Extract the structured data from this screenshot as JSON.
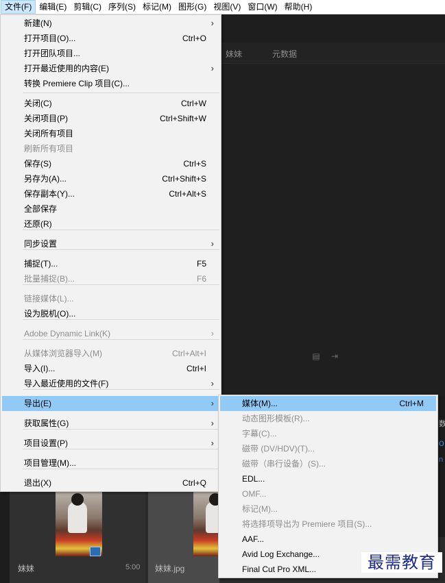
{
  "menubar": {
    "items": [
      "文件(F)",
      "编辑(E)",
      "剪辑(C)",
      "序列(S)",
      "标记(M)",
      "图形(G)",
      "视图(V)",
      "窗口(W)",
      "帮助(H)"
    ]
  },
  "panel": {
    "tabs": [
      "妹妹",
      "元数据"
    ]
  },
  "file_menu": {
    "items": [
      {
        "label": "新建(N)",
        "shortcut": "",
        "submenu": true,
        "disabled": false
      },
      {
        "label": "打开项目(O)...",
        "shortcut": "Ctrl+O",
        "submenu": false,
        "disabled": false
      },
      {
        "label": "打开团队项目...",
        "shortcut": "",
        "submenu": false,
        "disabled": false
      },
      {
        "label": "打开最近使用的内容(E)",
        "shortcut": "",
        "submenu": true,
        "disabled": false
      },
      {
        "label": "转换 Premiere Clip 项目(C)...",
        "shortcut": "",
        "submenu": false,
        "disabled": false
      },
      {
        "label": "关闭(C)",
        "shortcut": "Ctrl+W",
        "submenu": false,
        "disabled": false
      },
      {
        "label": "关闭项目(P)",
        "shortcut": "Ctrl+Shift+W",
        "submenu": false,
        "disabled": false
      },
      {
        "label": "关闭所有项目",
        "shortcut": "",
        "submenu": false,
        "disabled": false
      },
      {
        "label": "刷新所有项目",
        "shortcut": "",
        "submenu": false,
        "disabled": true
      },
      {
        "label": "保存(S)",
        "shortcut": "Ctrl+S",
        "submenu": false,
        "disabled": false
      },
      {
        "label": "另存为(A)...",
        "shortcut": "Ctrl+Shift+S",
        "submenu": false,
        "disabled": false
      },
      {
        "label": "保存副本(Y)...",
        "shortcut": "Ctrl+Alt+S",
        "submenu": false,
        "disabled": false
      },
      {
        "label": "全部保存",
        "shortcut": "",
        "submenu": false,
        "disabled": false
      },
      {
        "label": "还原(R)",
        "shortcut": "",
        "submenu": false,
        "disabled": false
      },
      {
        "label": "同步设置",
        "shortcut": "",
        "submenu": true,
        "disabled": false
      },
      {
        "label": "捕捉(T)...",
        "shortcut": "F5",
        "submenu": false,
        "disabled": false
      },
      {
        "label": "批量捕捉(B)...",
        "shortcut": "F6",
        "submenu": false,
        "disabled": true
      },
      {
        "label": "链接媒体(L)...",
        "shortcut": "",
        "submenu": false,
        "disabled": true
      },
      {
        "label": "设为脱机(O)...",
        "shortcut": "",
        "submenu": false,
        "disabled": false
      },
      {
        "label": "Adobe Dynamic Link(K)",
        "shortcut": "",
        "submenu": true,
        "disabled": true
      },
      {
        "label": "从媒体浏览器导入(M)",
        "shortcut": "Ctrl+Alt+I",
        "submenu": false,
        "disabled": true
      },
      {
        "label": "导入(I)...",
        "shortcut": "Ctrl+I",
        "submenu": false,
        "disabled": false
      },
      {
        "label": "导入最近使用的文件(F)",
        "shortcut": "",
        "submenu": true,
        "disabled": false
      },
      {
        "label": "导出(E)",
        "shortcut": "",
        "submenu": true,
        "disabled": false,
        "highlighted": true
      },
      {
        "label": "获取属性(G)",
        "shortcut": "",
        "submenu": true,
        "disabled": false
      },
      {
        "label": "项目设置(P)",
        "shortcut": "",
        "submenu": true,
        "disabled": false
      },
      {
        "label": "项目管理(M)...",
        "shortcut": "",
        "submenu": false,
        "disabled": false
      },
      {
        "label": "退出(X)",
        "shortcut": "Ctrl+Q",
        "submenu": false,
        "disabled": false
      }
    ]
  },
  "export_menu": {
    "items": [
      {
        "label": "媒体(M)...",
        "shortcut": "Ctrl+M",
        "disabled": false,
        "highlighted": true
      },
      {
        "label": "动态图形模板(R)...",
        "shortcut": "",
        "disabled": true
      },
      {
        "label": "字幕(C)...",
        "shortcut": "",
        "disabled": true
      },
      {
        "label": "磁带 (DV/HDV)(T)...",
        "shortcut": "",
        "disabled": true
      },
      {
        "label": "磁带（串行设备）(S)...",
        "shortcut": "",
        "disabled": true
      },
      {
        "label": "EDL...",
        "shortcut": "",
        "disabled": false
      },
      {
        "label": "OMF...",
        "shortcut": "",
        "disabled": true
      },
      {
        "label": "标记(M)...",
        "shortcut": "",
        "disabled": true
      },
      {
        "label": "将选择项导出为 Premiere 项目(S)...",
        "shortcut": "",
        "disabled": true
      },
      {
        "label": "AAF...",
        "shortcut": "",
        "disabled": false
      },
      {
        "label": "Avid Log Exchange...",
        "shortcut": "",
        "disabled": false
      },
      {
        "label": "Final Cut Pro XML...",
        "shortcut": "",
        "disabled": false
      }
    ]
  },
  "bin": {
    "items": [
      {
        "label": "妹妹",
        "duration": "5:00"
      },
      {
        "label": "妹妹.jpg",
        "duration": ""
      }
    ]
  },
  "watermark": "最需教育",
  "colors": {
    "menu_bg": "#f2f2f2",
    "highlight": "#91c9f7",
    "disabled_text": "#8d8d8d",
    "app_bg": "#1d1d1d",
    "watermark": "#1b2a8f"
  }
}
